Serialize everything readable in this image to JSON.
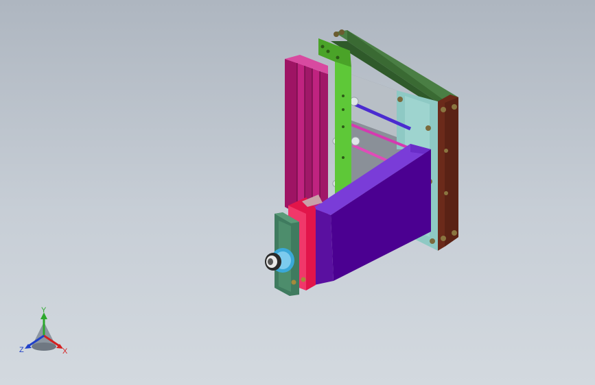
{
  "viewport": {
    "background_top": "#aeb6c0",
    "background_bottom": "#d3d9df"
  },
  "assembly": {
    "parts": [
      {
        "name": "top-frame-bar",
        "color": "#3e6e3a"
      },
      {
        "name": "green-vertical-plate",
        "color": "#55bf2a"
      },
      {
        "name": "back-plate",
        "color": "#8ec9c4"
      },
      {
        "name": "brown-side-plate",
        "color": "#6b2a1a"
      },
      {
        "name": "purple-housing",
        "color": "#4b0091"
      },
      {
        "name": "magenta-rails",
        "color": "#a8156a"
      },
      {
        "name": "red-end-plate",
        "color": "#e2154a"
      },
      {
        "name": "teal-mount-plate",
        "color": "#3f7b5f"
      },
      {
        "name": "motor",
        "color": "#3aa8d8"
      }
    ]
  },
  "triad": {
    "x_label": "X",
    "y_label": "Y",
    "z_label": "Z",
    "x_color": "#d42020",
    "y_color": "#2ca82c",
    "z_color": "#2040c8"
  }
}
